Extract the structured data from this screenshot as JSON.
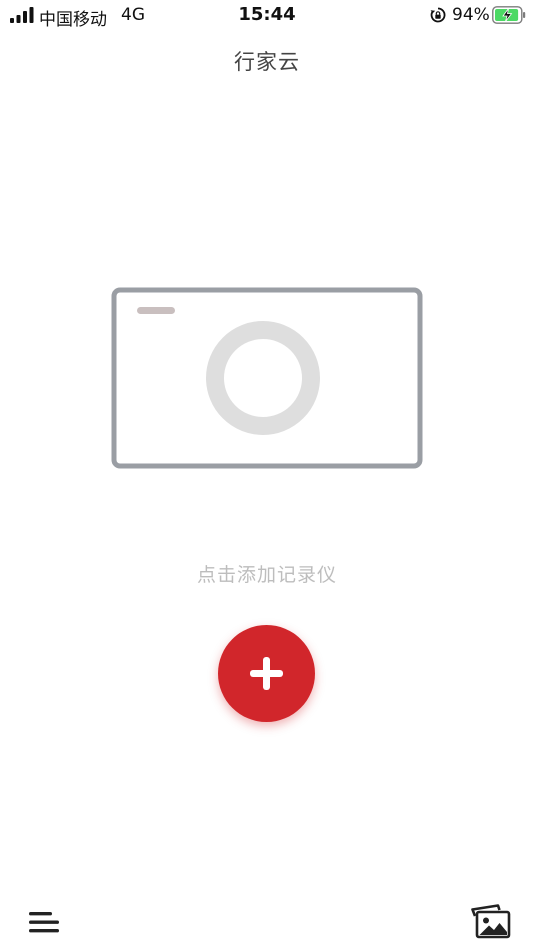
{
  "status_bar": {
    "carrier": "中国移动",
    "network": "4G",
    "time": "15:44",
    "battery_percent": "94%",
    "battery_level": 0.94,
    "signal_icon": "signal-bars-icon",
    "rotation_icon": "rotation-lock-icon",
    "battery_icon": "battery-charging-icon",
    "battery_color": "#4cd964"
  },
  "header": {
    "title": "行家云"
  },
  "empty_state": {
    "illustration_icon": "recorder-device-icon",
    "hint": "点击添加记录仪"
  },
  "actions": {
    "add_icon": "plus-icon",
    "add_color": "#d1262b"
  },
  "bottom_bar": {
    "menu_icon": "menu-icon",
    "gallery_icon": "gallery-icon"
  }
}
